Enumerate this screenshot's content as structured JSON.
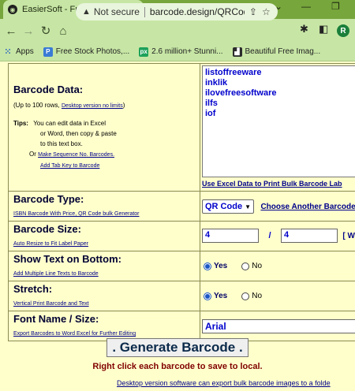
{
  "browser": {
    "tab_title": "EasierSoft - Free Bulk Online Mu",
    "tab_close": "×",
    "new_tab": "+",
    "not_secure": "Not secure",
    "url": "barcode.design/QRCod...",
    "profile_initial": "R",
    "bookmarks": [
      {
        "label": "Apps",
        "icon": "apps-grid-icon"
      },
      {
        "label": "Free Stock Photos,...",
        "icon": "free-stock-photos-icon"
      },
      {
        "label": "2.6 million+ Stunni...",
        "icon": "pexels-icon"
      },
      {
        "label": "Beautiful Free Imag...",
        "icon": "beautiful-free-images-icon"
      }
    ]
  },
  "form": {
    "barcode_data": {
      "heading": "Barcode Data:",
      "rows_note": "(Up to 100 rows,",
      "desktop_link": "Desktop version no limits",
      "rows_note_close": ")",
      "tips_label": "Tips:",
      "tips_line1": "You can edit data in Excel",
      "tips_line2": "or Word, then copy & paste",
      "tips_line3": "to this text box.",
      "or_label": "Or",
      "sequence_link": "Make Sequence No. Barcodes.",
      "tab_key_link": "Add Tab Key to Barcode",
      "lines": [
        "listoffreeware",
        "inklik",
        "ilovefreesoftware",
        "ilfs",
        "iof"
      ],
      "excel_link": "Use Excel Data to Print Bulk Barcode Lab"
    },
    "barcode_type": {
      "heading": "Barcode Type:",
      "sub_link": "ISBN Barcode With Price, QR Code bulk Generator",
      "selected": "QR Code",
      "choose_link": "Choose Another Barcode"
    },
    "barcode_size": {
      "heading": "Barcode Size:",
      "sub_link": "Auto Resize to Fit Label Paper",
      "width": "4",
      "height": "4",
      "slash": "/",
      "wid_label": "[ Wi"
    },
    "show_text": {
      "heading": "Show Text on Bottom:",
      "sub_link": "Add Multiple Line Texts to Barcode",
      "yes": "Yes",
      "no": "No",
      "selected": "Yes"
    },
    "stretch": {
      "heading": "Stretch:",
      "sub_link": "Vertical Print Barcode and Text",
      "yes": "Yes",
      "no": "No",
      "selected": "Yes"
    },
    "font": {
      "heading": "Font Name / Size:",
      "sub_link": "Export Barcodes to Word Excel for Further Editing",
      "value": "Arial"
    }
  },
  "generate_button": ". Generate Barcode .",
  "save_note": "Right click each barcode to save to local.",
  "desktop_note": "Desktop version software can export bulk barcode images to a folde"
}
